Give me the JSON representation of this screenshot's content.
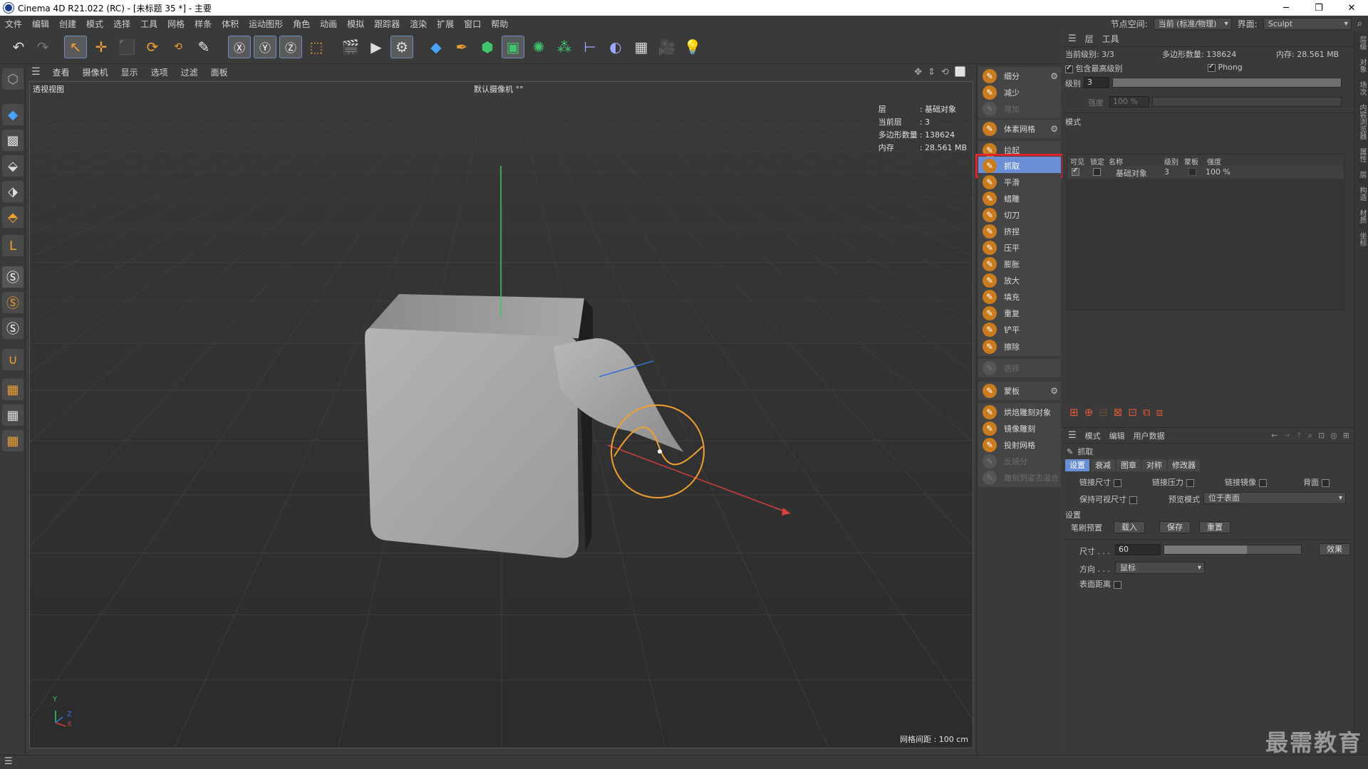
{
  "window": {
    "title": "Cinema 4D R21.022 (RC) - [未标题 35 *] - 主要",
    "minimize": "─",
    "restore": "❐",
    "close": "✕"
  },
  "menubar": {
    "items": [
      "文件",
      "编辑",
      "创建",
      "模式",
      "选择",
      "工具",
      "网格",
      "样条",
      "体积",
      "运动图形",
      "角色",
      "动画",
      "模拟",
      "跟踪器",
      "渲染",
      "扩展",
      "窗口",
      "帮助"
    ],
    "node_space_label": "节点空间:",
    "node_space_value": "当前 (标准/物理)",
    "layout_label": "界面:",
    "layout_value": "Sculpt"
  },
  "viewport_menu": {
    "items": [
      "查看",
      "摄像机",
      "显示",
      "选项",
      "过滤",
      "面板"
    ]
  },
  "viewport": {
    "name": "透视视图",
    "camera": "默认摄像机 °°",
    "hud": [
      {
        "k": "层",
        "v": ": 基础对象"
      },
      {
        "k": "当前层",
        "v": ": 3"
      },
      {
        "k": "多边形数量",
        "v": ": 138624"
      },
      {
        "k": "内存",
        "v": ": 28.561 MB"
      }
    ],
    "grid_spacing": "网格间距 : 100 cm",
    "axis_y": "Y",
    "axis_z": "Z",
    "axis_x": "X"
  },
  "sculpt_tools": [
    {
      "label": "细分",
      "state": "normal",
      "gear": true
    },
    {
      "label": "减少",
      "state": "normal"
    },
    {
      "label": "增加",
      "state": "dim"
    },
    {
      "label": "体素网格",
      "state": "normal",
      "gear": true
    },
    {
      "label": "拉起",
      "state": "normal"
    },
    {
      "label": "抓取",
      "state": "active"
    },
    {
      "label": "平滑",
      "state": "normal"
    },
    {
      "label": "蜡雕",
      "state": "normal"
    },
    {
      "label": "切刀",
      "state": "normal"
    },
    {
      "label": "挤捏",
      "state": "normal"
    },
    {
      "label": "压平",
      "state": "normal"
    },
    {
      "label": "膨胀",
      "state": "normal"
    },
    {
      "label": "放大",
      "state": "normal"
    },
    {
      "label": "填充",
      "state": "normal"
    },
    {
      "label": "重复",
      "state": "normal"
    },
    {
      "label": "铲平",
      "state": "normal"
    },
    {
      "label": "擦除",
      "state": "normal"
    },
    {
      "label": "选择",
      "state": "dim"
    },
    {
      "label": "蒙板",
      "state": "normal",
      "gear": true
    },
    {
      "label": "烘焙雕刻对象",
      "state": "normal"
    },
    {
      "label": "镜像雕刻",
      "state": "normal"
    },
    {
      "label": "投射网格",
      "state": "normal"
    },
    {
      "label": "反细分",
      "state": "dim"
    },
    {
      "label": "雕刻到姿态混合",
      "state": "dim"
    }
  ],
  "layers_panel": {
    "tabs": [
      "层",
      "工具"
    ],
    "current_level": "当前级别: 3/3",
    "poly_count": "多边形数量: 138624",
    "memory": "内存: 28.561 MB",
    "include_highest": "包含最高级别",
    "phong": "Phong",
    "level_label": "级别",
    "level_value": "3",
    "strength_label": "强度",
    "strength_value": "100 %",
    "mode_label": "模式",
    "columns": [
      "可见",
      "锁定",
      "名称",
      "级别",
      "蒙板",
      "强度"
    ],
    "rows": [
      {
        "name": "基础对象",
        "level": "3",
        "strength": "100 %"
      }
    ]
  },
  "attributes": {
    "menu": [
      "模式",
      "编辑",
      "用户数据"
    ],
    "tool_name": "抓取",
    "tabs": [
      "设置",
      "衰减",
      "图章",
      "对称",
      "修改器"
    ],
    "link_size": "链接尺寸",
    "link_pressure": "链接压力",
    "link_mirror": "链接镜像",
    "backface": "背面",
    "keep_visible_size": "保持可视尺寸",
    "preview_mode_label": "预览模式",
    "preview_mode_value": "位于表面",
    "section_settings": "设置",
    "brush_preset": "笔刷预置",
    "load": "载入",
    "save": "保存",
    "reset": "重置",
    "size_label": "尺寸 . . .",
    "size_value": "60",
    "effect": "效果",
    "direction_label": "方向 . . .",
    "direction_value": "鼠标",
    "surface_distance": "表面距离"
  },
  "side_tabs": [
    "层级",
    "对象",
    "场次",
    "内容浏览器",
    "属性",
    "层",
    "构造",
    "材质",
    "坐标"
  ],
  "watermark": "最需教育"
}
